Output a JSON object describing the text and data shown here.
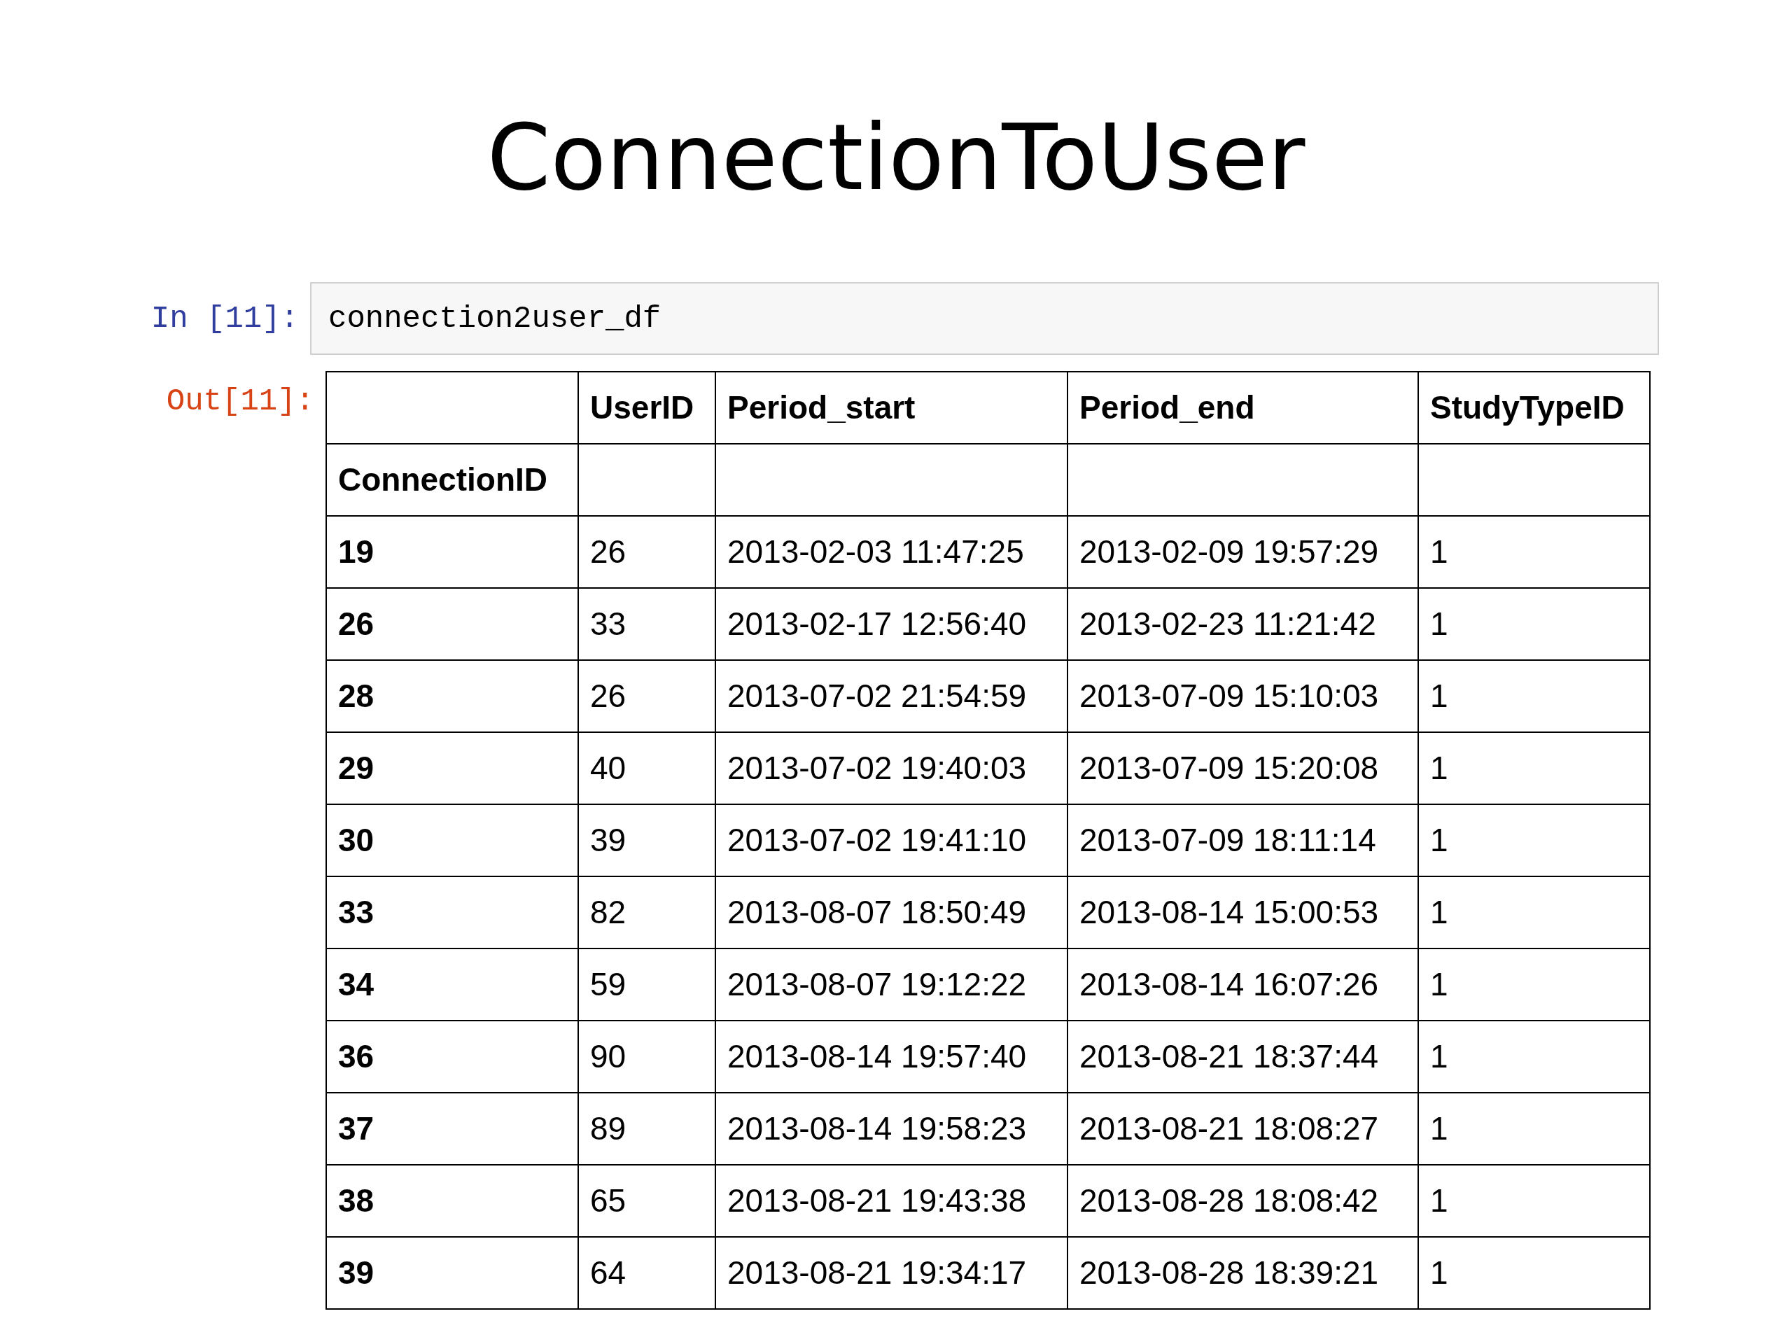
{
  "title": "ConnectionToUser",
  "input_cell": {
    "prompt": "In [11]:",
    "code": "connection2user_df"
  },
  "output_cell": {
    "prompt": "Out[11]:",
    "table": {
      "columns": [
        "UserID",
        "Period_start",
        "Period_end",
        "StudyTypeID"
      ],
      "index_name": "ConnectionID",
      "rows": [
        {
          "index": "19",
          "cells": [
            "26",
            "2013-02-03 11:47:25",
            "2013-02-09 19:57:29",
            "1"
          ]
        },
        {
          "index": "26",
          "cells": [
            "33",
            "2013-02-17 12:56:40",
            "2013-02-23 11:21:42",
            "1"
          ]
        },
        {
          "index": "28",
          "cells": [
            "26",
            "2013-07-02 21:54:59",
            "2013-07-09 15:10:03",
            "1"
          ]
        },
        {
          "index": "29",
          "cells": [
            "40",
            "2013-07-02 19:40:03",
            "2013-07-09 15:20:08",
            "1"
          ]
        },
        {
          "index": "30",
          "cells": [
            "39",
            "2013-07-02 19:41:10",
            "2013-07-09 18:11:14",
            "1"
          ]
        },
        {
          "index": "33",
          "cells": [
            "82",
            "2013-08-07 18:50:49",
            "2013-08-14 15:00:53",
            "1"
          ]
        },
        {
          "index": "34",
          "cells": [
            "59",
            "2013-08-07 19:12:22",
            "2013-08-14 16:07:26",
            "1"
          ]
        },
        {
          "index": "36",
          "cells": [
            "90",
            "2013-08-14 19:57:40",
            "2013-08-21 18:37:44",
            "1"
          ]
        },
        {
          "index": "37",
          "cells": [
            "89",
            "2013-08-14 19:58:23",
            "2013-08-21 18:08:27",
            "1"
          ]
        },
        {
          "index": "38",
          "cells": [
            "65",
            "2013-08-21 19:43:38",
            "2013-08-28 18:08:42",
            "1"
          ]
        },
        {
          "index": "39",
          "cells": [
            "64",
            "2013-08-21 19:34:17",
            "2013-08-28 18:39:21",
            "1"
          ]
        }
      ]
    }
  }
}
